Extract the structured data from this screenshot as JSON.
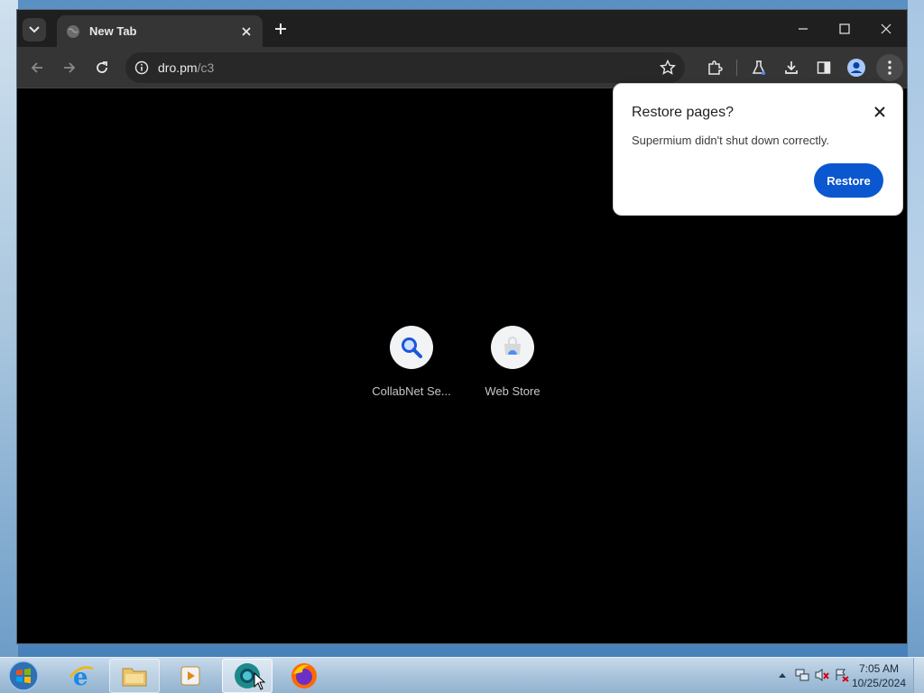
{
  "browser": {
    "tab": {
      "title": "New Tab"
    },
    "omnibox": {
      "host": "dro.pm",
      "path": "/c3"
    }
  },
  "restore_bubble": {
    "title": "Restore pages?",
    "message": "Supermium didn't shut down correctly.",
    "button_label": "Restore"
  },
  "shortcuts": [
    {
      "label": "CollabNet Se...",
      "icon": "search-icon"
    },
    {
      "label": "Web Store",
      "icon": "web-store-icon"
    }
  ],
  "taskbar": {
    "time": "7:05 AM",
    "date": "10/25/2024"
  },
  "colors": {
    "accent": "#0b57d0",
    "tab_bg": "#353535",
    "titlebar_bg": "#1f1f1f"
  }
}
